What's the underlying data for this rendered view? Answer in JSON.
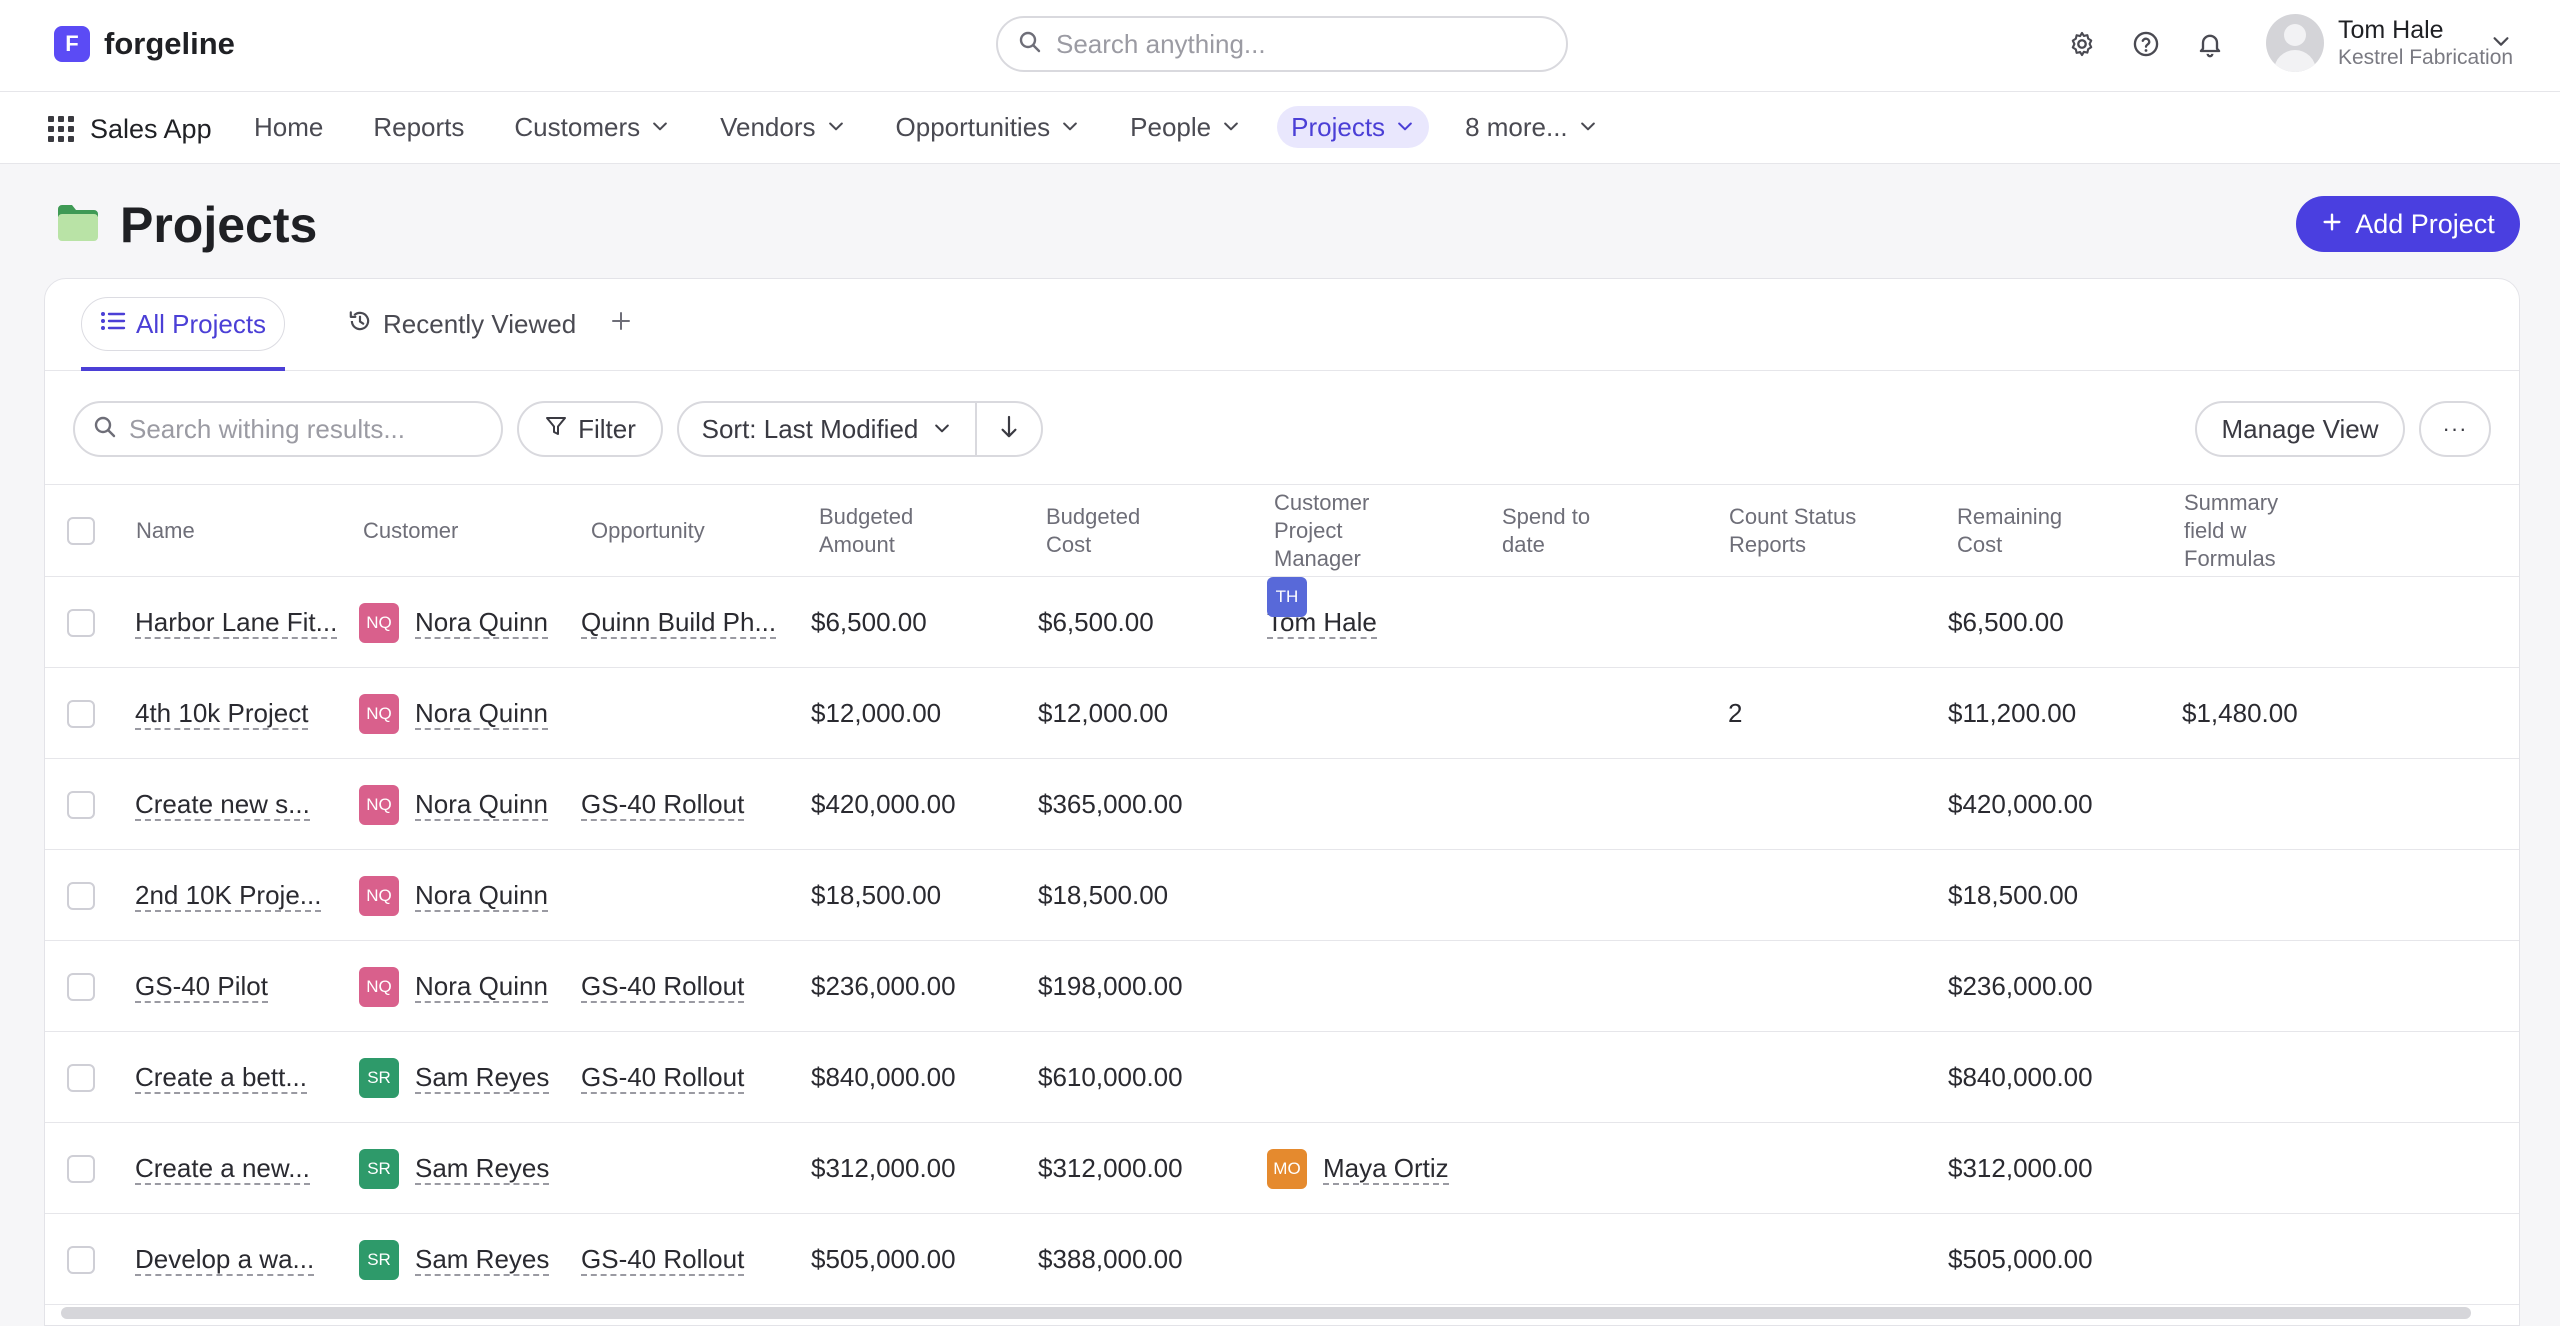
{
  "app": {
    "logo_letter": "F",
    "brand": "forgeline",
    "app_name": "Sales App"
  },
  "search": {
    "placeholder": "Search anything..."
  },
  "user": {
    "name": "Tom Hale",
    "org": "Kestrel Fabrication"
  },
  "nav": {
    "items": [
      {
        "label": "Home",
        "dropdown": false,
        "active": false
      },
      {
        "label": "Reports",
        "dropdown": false,
        "active": false
      },
      {
        "label": "Customers",
        "dropdown": true,
        "active": false
      },
      {
        "label": "Vendors",
        "dropdown": true,
        "active": false
      },
      {
        "label": "Opportunities",
        "dropdown": true,
        "active": false
      },
      {
        "label": "People",
        "dropdown": true,
        "active": false
      },
      {
        "label": "Projects",
        "dropdown": true,
        "active": true
      },
      {
        "label": "8 more...",
        "dropdown": true,
        "active": false
      }
    ]
  },
  "page": {
    "title": "Projects",
    "add_button": "Add Project"
  },
  "tabs": {
    "all": "All Projects",
    "recent": "Recently Viewed",
    "add": "+"
  },
  "toolbar": {
    "search_placeholder": "Search withing results...",
    "filter": "Filter",
    "sort": "Sort: Last Modified",
    "manage_view": "Manage View",
    "more": "···"
  },
  "table": {
    "columns": {
      "name": "Name",
      "customer": "Customer",
      "opportunity": "Opportunity",
      "budgeted_amount": "Budgeted Amount",
      "budgeted_cost": "Budgeted Cost",
      "cpm": "Customer Project Manager",
      "spend": "Spend to date",
      "count_status": "Count Status Reports",
      "remaining": "Remaining Cost",
      "summary": "Summary field w Formulas"
    },
    "rows": [
      {
        "name": "Harbor Lane Fit...",
        "customer_initials": "NQ",
        "customer": "Nora Quinn",
        "opportunity": "Quinn Build Ph...",
        "budgeted_amount": "$6,500.00",
        "budgeted_cost": "$6,500.00",
        "cpm_initials": "TH",
        "cpm": "Tom Hale",
        "spend": "",
        "count_status": "",
        "remaining": "$6,500.00",
        "summary": ""
      },
      {
        "name": "4th 10k Project",
        "customer_initials": "NQ",
        "customer": "Nora Quinn",
        "opportunity": "",
        "budgeted_amount": "$12,000.00",
        "budgeted_cost": "$12,000.00",
        "cpm_initials": "",
        "cpm": "",
        "spend": "",
        "count_status": "2",
        "remaining": "$11,200.00",
        "summary": "$1,480.00"
      },
      {
        "name": "Create new s...",
        "customer_initials": "NQ",
        "customer": "Nora Quinn",
        "opportunity": "GS-40 Rollout",
        "budgeted_amount": "$420,000.00",
        "budgeted_cost": "$365,000.00",
        "cpm_initials": "",
        "cpm": "",
        "spend": "",
        "count_status": "",
        "remaining": "$420,000.00",
        "summary": ""
      },
      {
        "name": "2nd 10K Proje...",
        "customer_initials": "NQ",
        "customer": "Nora Quinn",
        "opportunity": "",
        "budgeted_amount": "$18,500.00",
        "budgeted_cost": "$18,500.00",
        "cpm_initials": "",
        "cpm": "",
        "spend": "",
        "count_status": "",
        "remaining": "$18,500.00",
        "summary": ""
      },
      {
        "name": "GS-40 Pilot",
        "customer_initials": "NQ",
        "customer": "Nora Quinn",
        "opportunity": "GS-40 Rollout",
        "budgeted_amount": "$236,000.00",
        "budgeted_cost": "$198,000.00",
        "cpm_initials": "",
        "cpm": "",
        "spend": "",
        "count_status": "",
        "remaining": "$236,000.00",
        "summary": ""
      },
      {
        "name": "Create a bett...",
        "customer_initials": "SR",
        "customer": "Sam Reyes",
        "opportunity": "GS-40 Rollout",
        "budgeted_amount": "$840,000.00",
        "budgeted_cost": "$610,000.00",
        "cpm_initials": "",
        "cpm": "",
        "spend": "",
        "count_status": "",
        "remaining": "$840,000.00",
        "summary": ""
      },
      {
        "name": "Create a new...",
        "customer_initials": "SR",
        "customer": "Sam Reyes",
        "opportunity": "",
        "budgeted_amount": "$312,000.00",
        "budgeted_cost": "$312,000.00",
        "cpm_initials": "MO",
        "cpm": "Maya Ortiz",
        "spend": "",
        "count_status": "",
        "remaining": "$312,000.00",
        "summary": ""
      },
      {
        "name": "Develop a wa...",
        "customer_initials": "SR",
        "customer": "Sam Reyes",
        "opportunity": "GS-40 Rollout",
        "budgeted_amount": "$505,000.00",
        "budgeted_cost": "$388,000.00",
        "cpm_initials": "",
        "cpm": "",
        "spend": "",
        "count_status": "",
        "remaining": "$505,000.00",
        "summary": ""
      }
    ]
  },
  "colors": {
    "accent": "#4a3fe0",
    "active_nav_bg": "#e9e7fd",
    "badge_nq": "#d9608c",
    "badge_sr": "#2e9a6a",
    "badge_th": "#5869d9",
    "badge_mo": "#e58a2e"
  }
}
